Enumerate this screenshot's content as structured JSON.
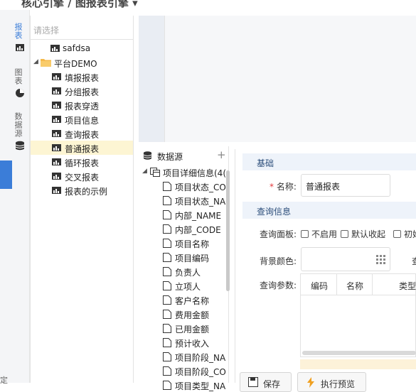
{
  "header": {
    "title": "核心引擎 / 图报表引擎 ▾"
  },
  "rail": {
    "items": [
      {
        "label": "报表",
        "icon": "report-icon",
        "active": true
      },
      {
        "label": "图表",
        "icon": "pie-chart-icon",
        "active": false
      },
      {
        "label": "数据源",
        "icon": "database-icon",
        "active": false
      }
    ],
    "edge_text": "定"
  },
  "tree": {
    "search_placeholder": "请选择",
    "nodes": [
      {
        "label": "safdsa",
        "icon": "report-icon",
        "level": 0
      },
      {
        "label": "平台DEMO",
        "icon": "folder-icon",
        "level": 0,
        "expanded": true
      },
      {
        "label": "填报报表",
        "icon": "report-icon",
        "level": 1
      },
      {
        "label": "分组报表",
        "icon": "report-icon",
        "level": 1
      },
      {
        "label": "报表穿透",
        "icon": "report-icon",
        "level": 1
      },
      {
        "label": "项目信息",
        "icon": "report-icon",
        "level": 1
      },
      {
        "label": "查询报表",
        "icon": "report-icon",
        "level": 1
      },
      {
        "label": "普通报表",
        "icon": "report-icon",
        "level": 1,
        "selected": true
      },
      {
        "label": "循环报表",
        "icon": "report-icon",
        "level": 1
      },
      {
        "label": "交叉报表",
        "icon": "report-icon",
        "level": 1
      },
      {
        "label": "报表的示例",
        "icon": "report-icon",
        "level": 1
      }
    ]
  },
  "datasource": {
    "title": "数据源",
    "add_label": "+",
    "root": "项目详细信息(4(",
    "fields": [
      "项目状态_CO",
      "项目状态_NA",
      "内部_NAME",
      "内部_CODE",
      "项目名称",
      "项目编码",
      "负责人",
      "立项人",
      "客户名称",
      "费用金额",
      "已用金额",
      "预计收入",
      "项目阶段_NA",
      "项目阶段_CO",
      "项目类型_NA"
    ]
  },
  "props": {
    "basic_title": "基础",
    "name_label": "名称:",
    "name_required": "*",
    "name_value": "普通报表",
    "query_title": "查询信息",
    "panel_label": "查询面板:",
    "panel_options": [
      "不启用",
      "默认收起",
      "初始"
    ],
    "bg_color_label": "背景颜色:",
    "bg_color_side_label": "查",
    "params_label": "查询参数:",
    "params_columns": [
      "编码",
      "名称",
      "类型"
    ]
  },
  "buttons": {
    "save": "保存",
    "preview": "执行预览"
  }
}
